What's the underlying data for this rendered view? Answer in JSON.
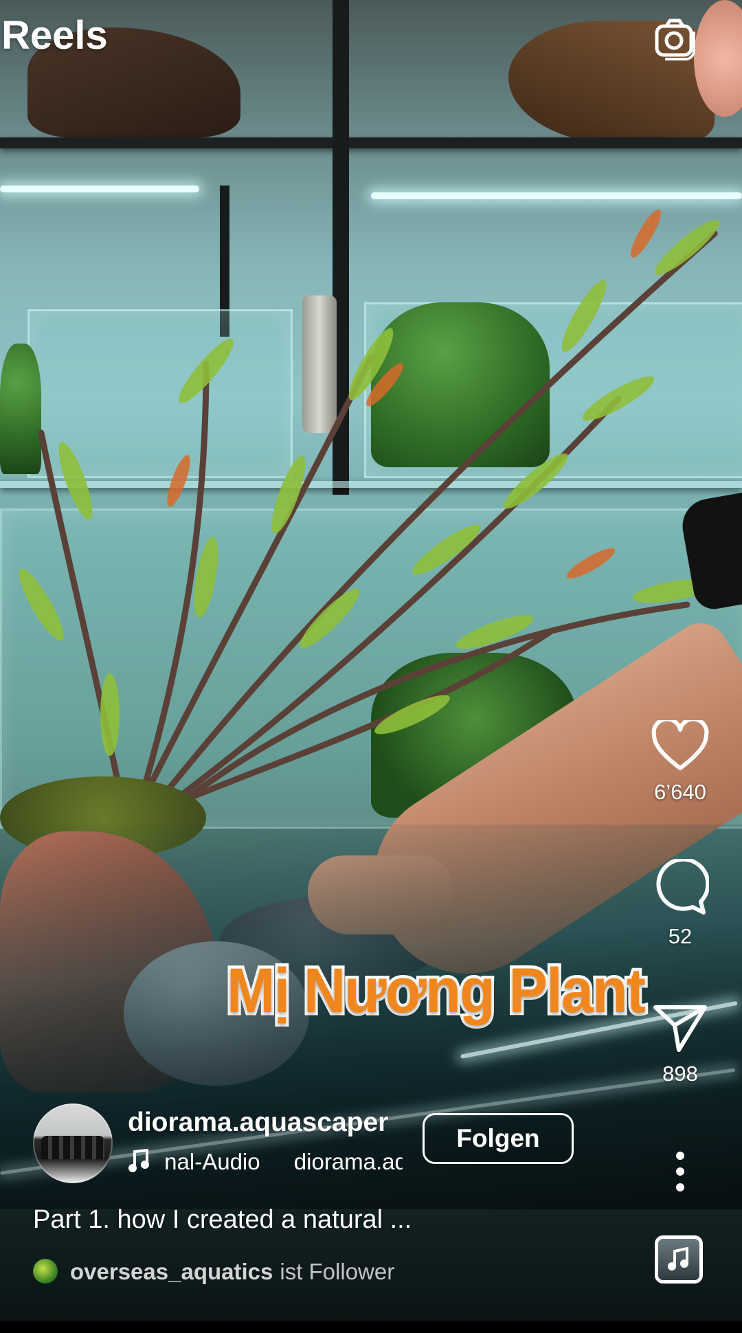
{
  "header": {
    "title": "Reels",
    "camera_icon": "camera-icon"
  },
  "video": {
    "overlay_caption": "Mị Nương Plant"
  },
  "actions": {
    "like": {
      "icon": "heart-icon",
      "count": "6’640"
    },
    "comment": {
      "icon": "comment-bubble-icon",
      "count": "52"
    },
    "share": {
      "icon": "paper-plane-icon",
      "count": "898"
    },
    "more": {
      "icon": "more-vertical-icon"
    }
  },
  "author": {
    "username": "diorama.aquascaper",
    "follow_label": "Folgen",
    "audio_icon": "music-note-icon",
    "audio_text": "nal-Audio",
    "audio_author": "diorama.aquascaper"
  },
  "caption": "Part 1. how I created a natural ...",
  "follower_hint": {
    "name": "overseas_aquatics",
    "suffix": "ist Follower"
  },
  "colors": {
    "overlay_caption": "#f0871e",
    "text": "#ffffff"
  }
}
